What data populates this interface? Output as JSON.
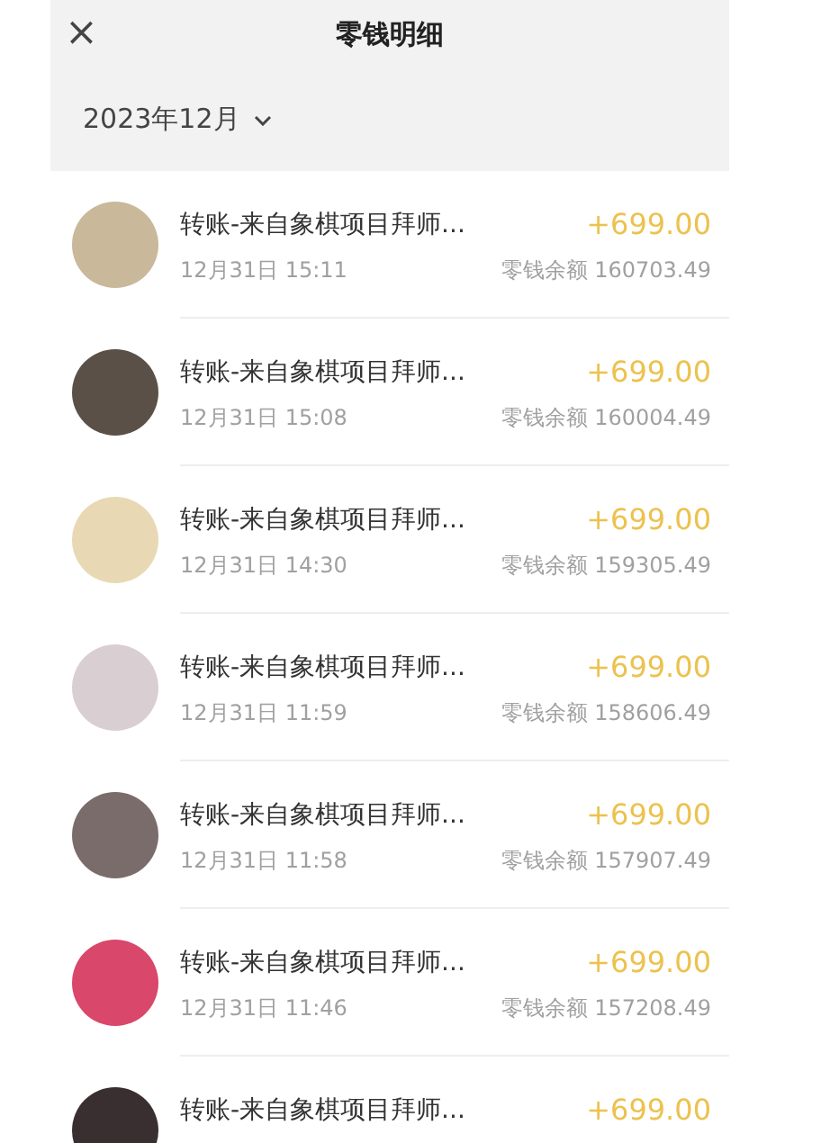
{
  "header": {
    "close": "×",
    "title": "零钱明细"
  },
  "month": {
    "label": "2023年12月"
  },
  "transactions": [
    {
      "title": "转账-来自象棋项目拜师...",
      "amount": "+699.00",
      "date": "12月31日 15:11",
      "balance": "零钱余额 160703.49"
    },
    {
      "title": "转账-来自象棋项目拜师...",
      "amount": "+699.00",
      "date": "12月31日 15:08",
      "balance": "零钱余额 160004.49"
    },
    {
      "title": "转账-来自象棋项目拜师...",
      "amount": "+699.00",
      "date": "12月31日 14:30",
      "balance": "零钱余额 159305.49"
    },
    {
      "title": "转账-来自象棋项目拜师...",
      "amount": "+699.00",
      "date": "12月31日 11:59",
      "balance": "零钱余额 158606.49"
    },
    {
      "title": "转账-来自象棋项目拜师...",
      "amount": "+699.00",
      "date": "12月31日 11:58",
      "balance": "零钱余额 157907.49"
    },
    {
      "title": "转账-来自象棋项目拜师...",
      "amount": "+699.00",
      "date": "12月31日 11:46",
      "balance": "零钱余额 157208.49"
    },
    {
      "title": "转账-来自象棋项目拜师...",
      "amount": "+699.00"
    }
  ]
}
